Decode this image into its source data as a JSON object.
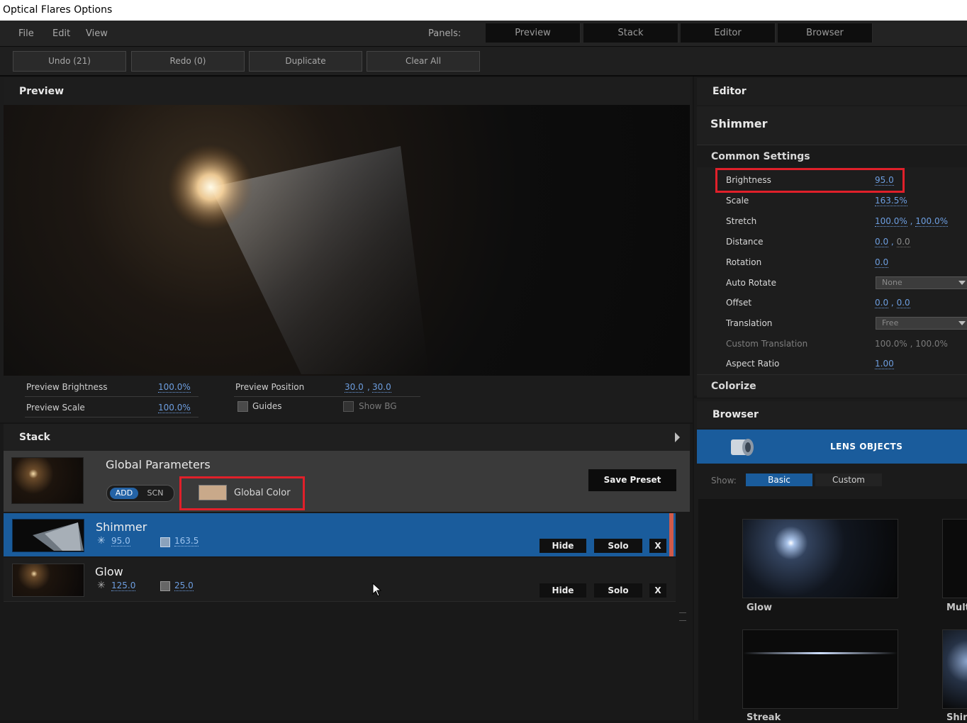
{
  "window": {
    "title": "Optical Flares Options"
  },
  "menu": {
    "items": [
      "File",
      "Edit",
      "View"
    ],
    "panels_label": "Panels:",
    "panels": [
      "Preview",
      "Stack",
      "Editor",
      "Browser"
    ]
  },
  "toolbar": {
    "undo": "Undo (21)",
    "redo": "Redo (0)",
    "duplicate": "Duplicate",
    "clear_all": "Clear All"
  },
  "preview": {
    "title": "Preview",
    "brightness_label": "Preview Brightness",
    "brightness_value": "100.0%",
    "scale_label": "Preview Scale",
    "scale_value": "100.0%",
    "position_label": "Preview Position",
    "position_x": "30.0",
    "position_sep": ",",
    "position_y": "30.0",
    "guides_label": "Guides",
    "show_bg_label": "Show BG"
  },
  "stack": {
    "title": "Stack",
    "global": {
      "title": "Global Parameters",
      "add": "ADD",
      "scn": "SCN",
      "color_label": "Global Color",
      "color": "#c9a98a",
      "save_preset": "Save Preset"
    },
    "rows": [
      {
        "name": "Shimmer",
        "brightness": "95.0",
        "scale": "163.5",
        "hide": "Hide",
        "solo": "Solo",
        "remove": "X",
        "selected": true
      },
      {
        "name": "Glow",
        "brightness": "125.0",
        "scale": "25.0",
        "hide": "Hide",
        "solo": "Solo",
        "remove": "X",
        "selected": false
      }
    ]
  },
  "editor": {
    "title": "Editor",
    "object_name": "Shimmer",
    "section_common": "Common Settings",
    "brightness_label": "Brightness",
    "brightness_value": "95.0",
    "scale_label": "Scale",
    "scale_value": "163.5%",
    "stretch_label": "Stretch",
    "stretch_x": "100.0%",
    "stretch_y": "100.0%",
    "distance_label": "Distance",
    "distance_x": "0.0",
    "distance_y": "0.0",
    "rotation_label": "Rotation",
    "rotation_value": "0.0",
    "auto_rotate_label": "Auto Rotate",
    "auto_rotate_value": "None",
    "offset_label": "Offset",
    "offset_x": "0.0",
    "offset_y": "0.0",
    "translation_label": "Translation",
    "translation_value": "Free",
    "custom_translation_label": "Custom Translation",
    "custom_translation_value": "100.0% , 100.0%",
    "aspect_ratio_label": "Aspect Ratio",
    "aspect_ratio_value": "1.00",
    "sep": ",",
    "section_colorize": "Colorize"
  },
  "browser": {
    "title": "Browser",
    "category": "LENS OBJECTS",
    "show_label": "Show:",
    "tabs": [
      "Basic",
      "Custom"
    ],
    "tiles": [
      "Glow",
      "Mult",
      "Streak",
      "Shin"
    ]
  },
  "colors": {
    "accent": "#1a5c9c",
    "link": "#6d9ee0",
    "highlight_box": "#e0202a"
  }
}
